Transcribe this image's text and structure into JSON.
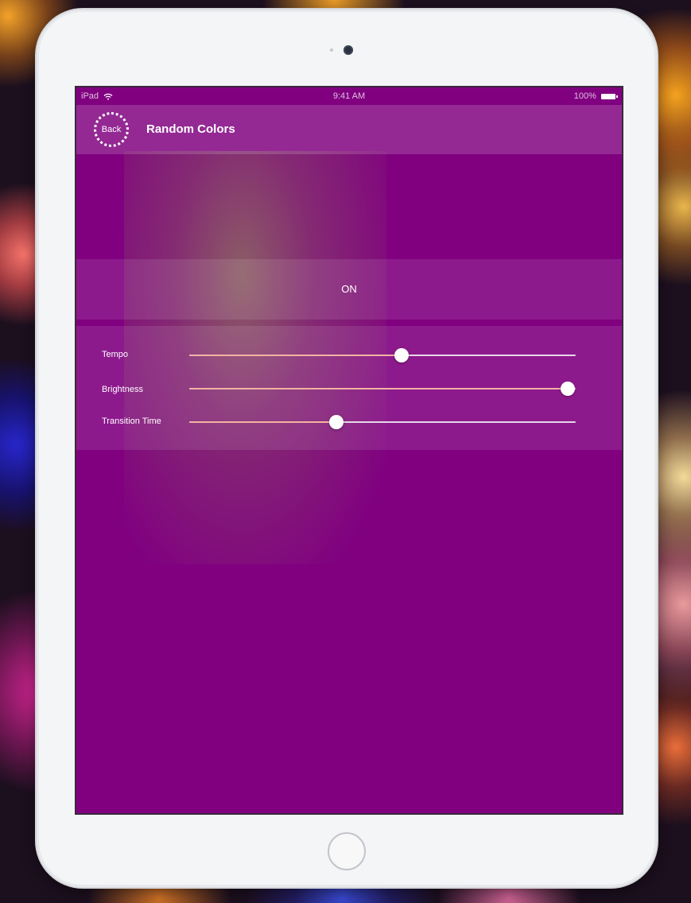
{
  "status_bar": {
    "device": "iPad",
    "time": "9:41 AM",
    "battery": "100%"
  },
  "nav": {
    "back_label": "Back",
    "title": "Random Colors"
  },
  "toggle": {
    "label": "ON"
  },
  "sliders": [
    {
      "label": "Tempo",
      "value_percent": 55
    },
    {
      "label": "Brightness",
      "value_percent": 98
    },
    {
      "label": "Transition Time",
      "value_percent": 38
    }
  ],
  "colors": {
    "background": "#800080",
    "track": "#e6d8ea",
    "thumb": "#ffffff"
  },
  "icons": [
    "wifi-icon",
    "battery-icon"
  ]
}
